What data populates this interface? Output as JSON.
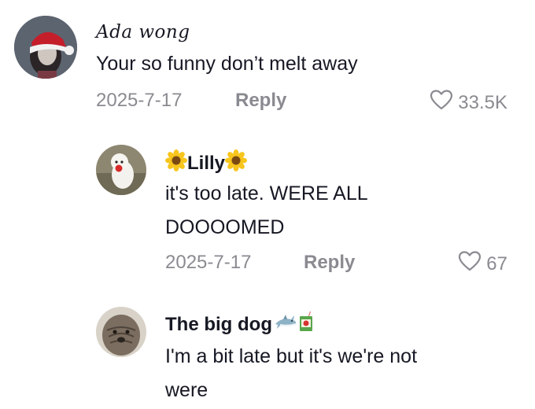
{
  "comments": [
    {
      "username": "Ada wong",
      "text": "Your so funny don’t melt away",
      "date": "2025-7-17",
      "reply_label": "Reply",
      "likes": "33.5K",
      "avatar_icon": "avatar-ada-wong-santa-hat"
    },
    {
      "username": "Lilly",
      "username_decoration": "sunflower-emoji",
      "text_lines": [
        "it's too late. WERE ALL",
        "DOOOOMED"
      ],
      "date": "2025-7-17",
      "reply_label": "Reply",
      "likes": "67",
      "avatar_icon": "avatar-white-dog"
    },
    {
      "username": "The big dog",
      "username_decoration": "shark-emoji juice-box-emoji",
      "text_lines": [
        "I'm a bit late but it's we're not",
        "were"
      ],
      "avatar_icon": "avatar-wrinkled-dog"
    }
  ],
  "colors": {
    "primary_text": "#161823",
    "secondary_text": "#8a8b91",
    "background": "#ffffff"
  }
}
